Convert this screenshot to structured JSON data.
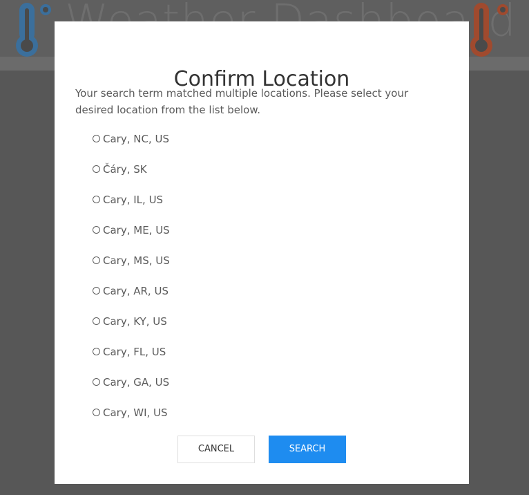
{
  "background": {
    "title": "Weather Dashboard"
  },
  "modal": {
    "title": "Confirm Location",
    "message": "Your search term matched multiple locations. Please select your desired location from the list below.",
    "options": [
      "Cary, NC, US",
      "Čáry, SK",
      "Cary, IL, US",
      "Cary, ME, US",
      "Cary, MS, US",
      "Cary, AR, US",
      "Cary, KY, US",
      "Cary, FL, US",
      "Cary, GA, US",
      "Cary, WI, US"
    ],
    "cancel_label": "CANCEL",
    "search_label": "SEARCH"
  },
  "colors": {
    "accent": "#1e8cf0",
    "thermo_left": "#3b6f9c",
    "thermo_right": "#a04a2e"
  },
  "icons": {
    "left": "thermometer-icon",
    "right": "thermometer-icon"
  }
}
